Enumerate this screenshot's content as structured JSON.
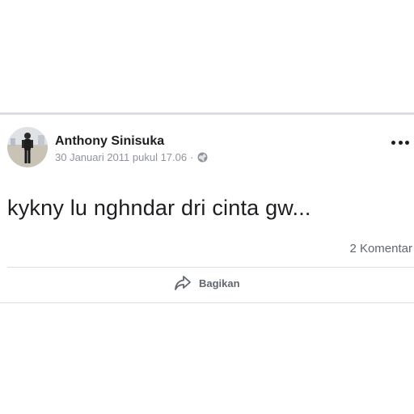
{
  "post": {
    "author": "Anthony Sinisuka",
    "timestamp": "30 Januari 2011 pukul 17.06",
    "separator": "·",
    "privacy_icon": "globe-icon",
    "body": "kykny lu nghndar dri cinta gw...",
    "comments_count": "2 Komentar",
    "more_icon": "more-options-icon"
  },
  "actions": {
    "share_label": "Bagikan",
    "share_icon": "share-arrow-icon"
  },
  "colors": {
    "text_primary": "#1c1e21",
    "text_secondary": "#90949c",
    "action_text": "#606770",
    "divider": "#dadde1"
  }
}
